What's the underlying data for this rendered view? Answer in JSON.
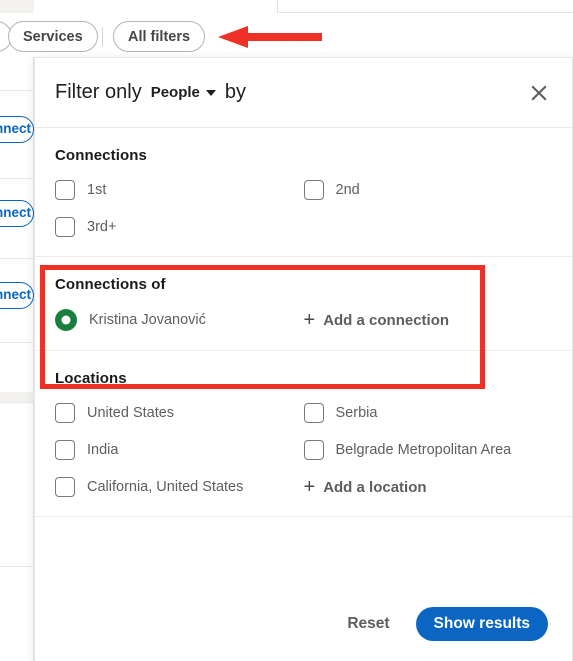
{
  "colors": {
    "accent": "#0a66c2",
    "annotation_red": "#ee3124",
    "avatar_green": "#1a7f3c",
    "text_primary": "#1a1a1a",
    "text_secondary": "#5e5e5e"
  },
  "background": {
    "connect_button_label": "Connect"
  },
  "pillbar": {
    "partial_pill_label": "",
    "services_label": "Services",
    "all_filters_label": "All filters"
  },
  "modal": {
    "header": {
      "prefix": "Filter only",
      "entity": "People",
      "suffix": "by",
      "close_icon": "close-icon",
      "caret_icon": "chevron-down-icon"
    },
    "sections": [
      {
        "id": "connections",
        "title": "Connections",
        "options": [
          {
            "label": "1st",
            "checked": false
          },
          {
            "label": "2nd",
            "checked": false
          },
          {
            "label": "3rd+",
            "checked": false
          }
        ]
      },
      {
        "id": "connections-of",
        "title": "Connections of",
        "person": {
          "name": "Kristina Jovanović",
          "avatar_icon": "avatar-ring-icon",
          "selected": true
        },
        "add_label": "Add a connection",
        "add_icon": "plus-icon"
      },
      {
        "id": "locations",
        "title": "Locations",
        "options": [
          {
            "label": "United States",
            "checked": false
          },
          {
            "label": "Serbia",
            "checked": false
          },
          {
            "label": "India",
            "checked": false
          },
          {
            "label": "Belgrade Metropolitan Area",
            "checked": false
          },
          {
            "label": "California, United States",
            "checked": false
          }
        ],
        "add_label": "Add a location",
        "add_icon": "plus-icon"
      }
    ],
    "footer": {
      "reset_label": "Reset",
      "show_results_label": "Show results"
    }
  },
  "annotations": {
    "arrow": {
      "icon": "left-arrow-annotation",
      "points_to": "All filters"
    },
    "highlight_box": {
      "icon": "rectangle-highlight-annotation",
      "surrounds": "Connections of"
    }
  }
}
